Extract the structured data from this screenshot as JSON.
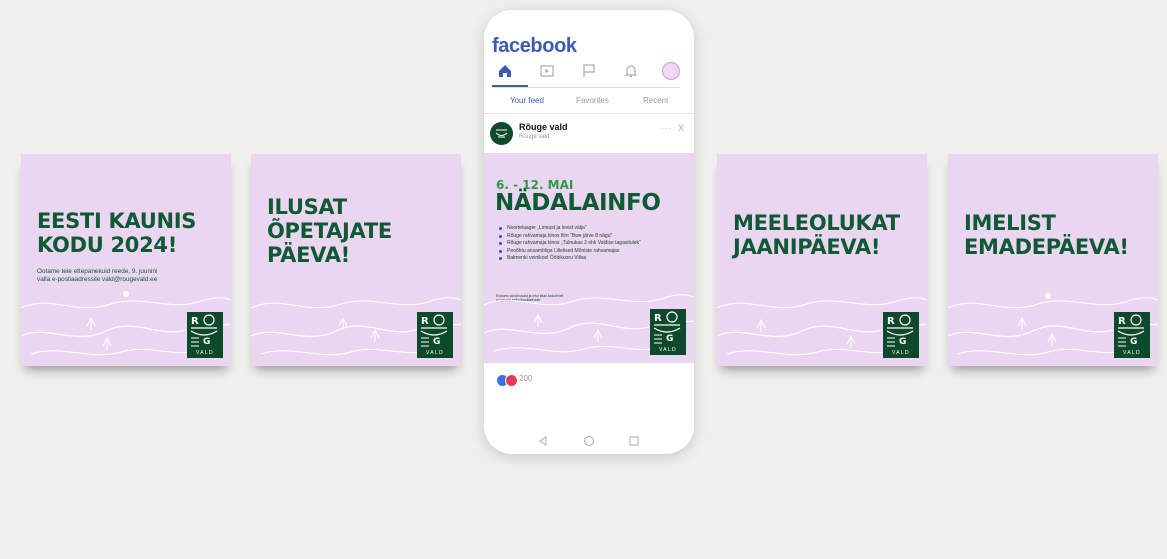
{
  "cards": [
    {
      "title_lines": [
        "EESTI KAUNIS",
        "KODU 2024!"
      ],
      "subtitle_lines": [
        "Ootame teie ettepanekuid reede, 9. juunini",
        "valla e-postiaadressile vald@rougevald.ee"
      ]
    },
    {
      "title_lines": [
        "ILUSAT",
        "ÕPETAJATE",
        "PÄEVA!"
      ]
    },
    {
      "title_lines": [
        "MEELEOLUKAT",
        "JAANIPÄEVA!"
      ]
    },
    {
      "title_lines": [
        "IMELIST",
        "EMADEPÄEVA!"
      ]
    }
  ],
  "logo": {
    "letters": "RGUGE",
    "text": "VALD"
  },
  "phone": {
    "app_name": "facebook",
    "nav_icons": [
      "home-icon",
      "video-icon",
      "flag-icon",
      "bell-icon",
      "profile-avatar"
    ],
    "tabs": [
      "Your feed",
      "Favorites",
      "Recent"
    ],
    "active_tab": "Your feed",
    "post": {
      "author": "Rõuge vald",
      "author_sub": "Rõuge vald",
      "more": "···",
      "close": "X",
      "image": {
        "date": "6. - 12. MAI",
        "title": "NÄDALAINFO",
        "items": [
          "Noortelaager „Linnast ja levist välja”",
          "Rõuge rahvamaja kinos film \"Bwe järve 8 nägu\"",
          "Rõuge rahvamaja kinos „Tulnukas 2 ehk Valdise tagasitulek”",
          "Peoõhtu ansambliga Lillelised Mõniste rahvamajas",
          "Bałmenki veinikool Ööbikuoru Villas"
        ],
        "footnote_lines": [
          "Rohkem sündmusaid ja infot leiad kodulehelt",
          "rougevald.ee/kultuurikalender"
        ]
      },
      "reactions": {
        "count": "200"
      }
    },
    "system_nav": [
      "back-icon",
      "home-circle-icon",
      "recents-icon"
    ]
  },
  "colors": {
    "card_bg": "#ead6f1",
    "brand_green": "#0f5a34",
    "fb_blue": "#3d5bb3",
    "date_green": "#2d9a47"
  }
}
